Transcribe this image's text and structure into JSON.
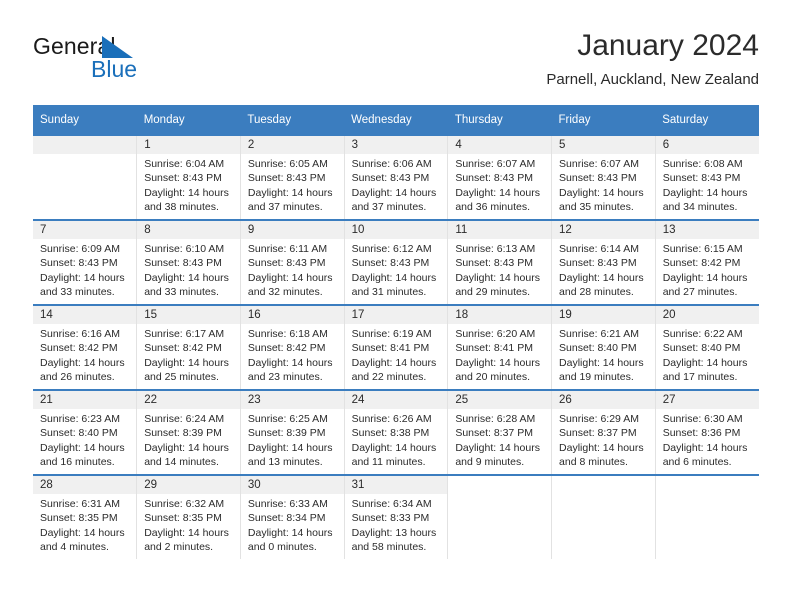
{
  "brand": {
    "name_part1": "General",
    "name_part2": "Blue",
    "accent_color": "#1a6fba",
    "header_color": "#3b7dbf"
  },
  "header": {
    "title": "January 2024",
    "location": "Parnell, Auckland, New Zealand"
  },
  "weekday_headers": [
    "Sunday",
    "Monday",
    "Tuesday",
    "Wednesday",
    "Thursday",
    "Friday",
    "Saturday"
  ],
  "labels": {
    "sunrise_prefix": "Sunrise:",
    "sunset_prefix": "Sunset:",
    "daylight_prefix": "Daylight:"
  },
  "weeks": [
    [
      {
        "day": "",
        "empty": true
      },
      {
        "day": "1",
        "sunrise": "Sunrise: 6:04 AM",
        "sunset": "Sunset: 8:43 PM",
        "daylight_line1": "Daylight: 14 hours",
        "daylight_line2": "and 38 minutes."
      },
      {
        "day": "2",
        "sunrise": "Sunrise: 6:05 AM",
        "sunset": "Sunset: 8:43 PM",
        "daylight_line1": "Daylight: 14 hours",
        "daylight_line2": "and 37 minutes."
      },
      {
        "day": "3",
        "sunrise": "Sunrise: 6:06 AM",
        "sunset": "Sunset: 8:43 PM",
        "daylight_line1": "Daylight: 14 hours",
        "daylight_line2": "and 37 minutes."
      },
      {
        "day": "4",
        "sunrise": "Sunrise: 6:07 AM",
        "sunset": "Sunset: 8:43 PM",
        "daylight_line1": "Daylight: 14 hours",
        "daylight_line2": "and 36 minutes."
      },
      {
        "day": "5",
        "sunrise": "Sunrise: 6:07 AM",
        "sunset": "Sunset: 8:43 PM",
        "daylight_line1": "Daylight: 14 hours",
        "daylight_line2": "and 35 minutes."
      },
      {
        "day": "6",
        "sunrise": "Sunrise: 6:08 AM",
        "sunset": "Sunset: 8:43 PM",
        "daylight_line1": "Daylight: 14 hours",
        "daylight_line2": "and 34 minutes."
      }
    ],
    [
      {
        "day": "7",
        "sunrise": "Sunrise: 6:09 AM",
        "sunset": "Sunset: 8:43 PM",
        "daylight_line1": "Daylight: 14 hours",
        "daylight_line2": "and 33 minutes."
      },
      {
        "day": "8",
        "sunrise": "Sunrise: 6:10 AM",
        "sunset": "Sunset: 8:43 PM",
        "daylight_line1": "Daylight: 14 hours",
        "daylight_line2": "and 33 minutes."
      },
      {
        "day": "9",
        "sunrise": "Sunrise: 6:11 AM",
        "sunset": "Sunset: 8:43 PM",
        "daylight_line1": "Daylight: 14 hours",
        "daylight_line2": "and 32 minutes."
      },
      {
        "day": "10",
        "sunrise": "Sunrise: 6:12 AM",
        "sunset": "Sunset: 8:43 PM",
        "daylight_line1": "Daylight: 14 hours",
        "daylight_line2": "and 31 minutes."
      },
      {
        "day": "11",
        "sunrise": "Sunrise: 6:13 AM",
        "sunset": "Sunset: 8:43 PM",
        "daylight_line1": "Daylight: 14 hours",
        "daylight_line2": "and 29 minutes."
      },
      {
        "day": "12",
        "sunrise": "Sunrise: 6:14 AM",
        "sunset": "Sunset: 8:43 PM",
        "daylight_line1": "Daylight: 14 hours",
        "daylight_line2": "and 28 minutes."
      },
      {
        "day": "13",
        "sunrise": "Sunrise: 6:15 AM",
        "sunset": "Sunset: 8:42 PM",
        "daylight_line1": "Daylight: 14 hours",
        "daylight_line2": "and 27 minutes."
      }
    ],
    [
      {
        "day": "14",
        "sunrise": "Sunrise: 6:16 AM",
        "sunset": "Sunset: 8:42 PM",
        "daylight_line1": "Daylight: 14 hours",
        "daylight_line2": "and 26 minutes."
      },
      {
        "day": "15",
        "sunrise": "Sunrise: 6:17 AM",
        "sunset": "Sunset: 8:42 PM",
        "daylight_line1": "Daylight: 14 hours",
        "daylight_line2": "and 25 minutes."
      },
      {
        "day": "16",
        "sunrise": "Sunrise: 6:18 AM",
        "sunset": "Sunset: 8:42 PM",
        "daylight_line1": "Daylight: 14 hours",
        "daylight_line2": "and 23 minutes."
      },
      {
        "day": "17",
        "sunrise": "Sunrise: 6:19 AM",
        "sunset": "Sunset: 8:41 PM",
        "daylight_line1": "Daylight: 14 hours",
        "daylight_line2": "and 22 minutes."
      },
      {
        "day": "18",
        "sunrise": "Sunrise: 6:20 AM",
        "sunset": "Sunset: 8:41 PM",
        "daylight_line1": "Daylight: 14 hours",
        "daylight_line2": "and 20 minutes."
      },
      {
        "day": "19",
        "sunrise": "Sunrise: 6:21 AM",
        "sunset": "Sunset: 8:40 PM",
        "daylight_line1": "Daylight: 14 hours",
        "daylight_line2": "and 19 minutes."
      },
      {
        "day": "20",
        "sunrise": "Sunrise: 6:22 AM",
        "sunset": "Sunset: 8:40 PM",
        "daylight_line1": "Daylight: 14 hours",
        "daylight_line2": "and 17 minutes."
      }
    ],
    [
      {
        "day": "21",
        "sunrise": "Sunrise: 6:23 AM",
        "sunset": "Sunset: 8:40 PM",
        "daylight_line1": "Daylight: 14 hours",
        "daylight_line2": "and 16 minutes."
      },
      {
        "day": "22",
        "sunrise": "Sunrise: 6:24 AM",
        "sunset": "Sunset: 8:39 PM",
        "daylight_line1": "Daylight: 14 hours",
        "daylight_line2": "and 14 minutes."
      },
      {
        "day": "23",
        "sunrise": "Sunrise: 6:25 AM",
        "sunset": "Sunset: 8:39 PM",
        "daylight_line1": "Daylight: 14 hours",
        "daylight_line2": "and 13 minutes."
      },
      {
        "day": "24",
        "sunrise": "Sunrise: 6:26 AM",
        "sunset": "Sunset: 8:38 PM",
        "daylight_line1": "Daylight: 14 hours",
        "daylight_line2": "and 11 minutes."
      },
      {
        "day": "25",
        "sunrise": "Sunrise: 6:28 AM",
        "sunset": "Sunset: 8:37 PM",
        "daylight_line1": "Daylight: 14 hours",
        "daylight_line2": "and 9 minutes."
      },
      {
        "day": "26",
        "sunrise": "Sunrise: 6:29 AM",
        "sunset": "Sunset: 8:37 PM",
        "daylight_line1": "Daylight: 14 hours",
        "daylight_line2": "and 8 minutes."
      },
      {
        "day": "27",
        "sunrise": "Sunrise: 6:30 AM",
        "sunset": "Sunset: 8:36 PM",
        "daylight_line1": "Daylight: 14 hours",
        "daylight_line2": "and 6 minutes."
      }
    ],
    [
      {
        "day": "28",
        "sunrise": "Sunrise: 6:31 AM",
        "sunset": "Sunset: 8:35 PM",
        "daylight_line1": "Daylight: 14 hours",
        "daylight_line2": "and 4 minutes."
      },
      {
        "day": "29",
        "sunrise": "Sunrise: 6:32 AM",
        "sunset": "Sunset: 8:35 PM",
        "daylight_line1": "Daylight: 14 hours",
        "daylight_line2": "and 2 minutes."
      },
      {
        "day": "30",
        "sunrise": "Sunrise: 6:33 AM",
        "sunset": "Sunset: 8:34 PM",
        "daylight_line1": "Daylight: 14 hours",
        "daylight_line2": "and 0 minutes."
      },
      {
        "day": "31",
        "sunrise": "Sunrise: 6:34 AM",
        "sunset": "Sunset: 8:33 PM",
        "daylight_line1": "Daylight: 13 hours",
        "daylight_line2": "and 58 minutes."
      },
      {
        "day": "",
        "empty": true,
        "blank": true
      },
      {
        "day": "",
        "empty": true,
        "blank": true
      },
      {
        "day": "",
        "empty": true,
        "blank": true
      }
    ]
  ]
}
